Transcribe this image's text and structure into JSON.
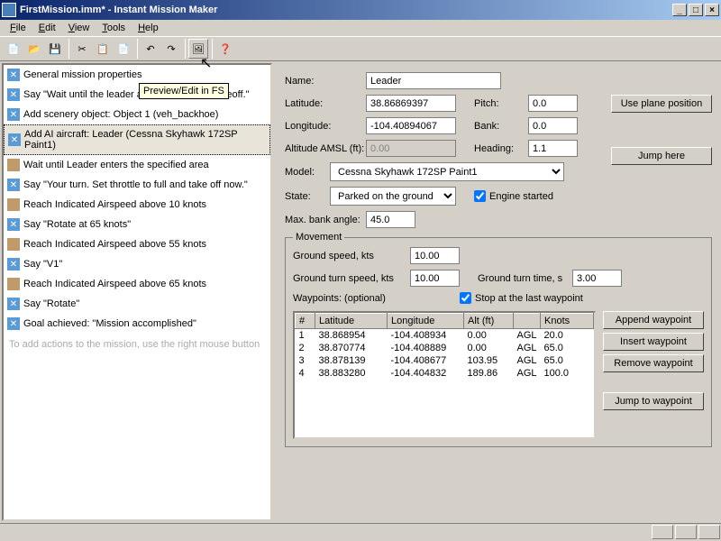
{
  "window": {
    "title": "FirstMission.imm* - Instant Mission Maker",
    "min": "_",
    "max": "□",
    "close": "×"
  },
  "menu": {
    "file": "File",
    "edit": "Edit",
    "view": "View",
    "tools": "Tools",
    "help": "Help"
  },
  "tooltip": "Preview/Edit in FS",
  "actions": [
    {
      "type": "x",
      "txt": "General mission properties"
    },
    {
      "type": "x",
      "txt": "Say \"Wait until the leader aircraft starts the takeoff.\""
    },
    {
      "type": "x",
      "txt": "Add scenery object: Object  1 (veh_backhoe)"
    },
    {
      "type": "x",
      "txt": "Add AI aircraft: Leader (Cessna Skyhawk 172SP Paint1)",
      "sel": true
    },
    {
      "type": "b",
      "txt": "Wait until Leader enters the specified area"
    },
    {
      "type": "x",
      "txt": "Say \"Your turn. Set throttle to full and take off now.\""
    },
    {
      "type": "b",
      "txt": "Reach Indicated Airspeed above 10 knots"
    },
    {
      "type": "x",
      "txt": "Say \"Rotate at 65 knots\""
    },
    {
      "type": "b",
      "txt": "Reach Indicated Airspeed above 55 knots"
    },
    {
      "type": "x",
      "txt": "Say \"V1\""
    },
    {
      "type": "b",
      "txt": "Reach Indicated Airspeed above 65 knots"
    },
    {
      "type": "x",
      "txt": "Say \"Rotate\""
    },
    {
      "type": "x",
      "txt": "Goal achieved: \"Mission accomplished\""
    }
  ],
  "hint": "To add actions to the mission, use the right mouse button",
  "form": {
    "name_l": "Name:",
    "name": "Leader",
    "lat_l": "Latitude:",
    "lat": "38.86869397",
    "lon_l": "Longitude:",
    "lon": "-104.40894067",
    "alt_l": "Altitude AMSL (ft):",
    "alt": "0.00",
    "pitch_l": "Pitch:",
    "pitch": "0.0",
    "bank_l": "Bank:",
    "bank": "0.0",
    "head_l": "Heading:",
    "head": "1.1",
    "model_l": "Model:",
    "model": "Cessna Skyhawk 172SP Paint1",
    "state_l": "State:",
    "state": "Parked on the ground",
    "engine": "Engine started",
    "maxbank_l": "Max. bank angle:",
    "maxbank": "45.0",
    "btn_pos": "Use plane position",
    "btn_jump": "Jump here"
  },
  "movement": {
    "title": "Movement",
    "gs_l": "Ground speed, kts",
    "gs": "10.00",
    "gts_l": "Ground turn speed, kts",
    "gts": "10.00",
    "gtt_l": "Ground turn time, s",
    "gtt": "3.00",
    "wp_l": "Waypoints: (optional)",
    "stop": "Stop at the last waypoint",
    "headers": {
      "n": "#",
      "lat": "Latitude",
      "lon": "Longitude",
      "alt": "Alt (ft)",
      "agl": "",
      "kts": "Knots"
    },
    "rows": [
      {
        "n": "1",
        "lat": "38.868954",
        "lon": "-104.408934",
        "alt": "0.00",
        "agl": "AGL",
        "kts": "20.0"
      },
      {
        "n": "2",
        "lat": "38.870774",
        "lon": "-104.408889",
        "alt": "0.00",
        "agl": "AGL",
        "kts": "65.0"
      },
      {
        "n": "3",
        "lat": "38.878139",
        "lon": "-104.408677",
        "alt": "103.95",
        "agl": "AGL",
        "kts": "65.0"
      },
      {
        "n": "4",
        "lat": "38.883280",
        "lon": "-104.404832",
        "alt": "189.86",
        "agl": "AGL",
        "kts": "100.0"
      }
    ],
    "btn_append": "Append waypoint",
    "btn_insert": "Insert waypoint",
    "btn_remove": "Remove waypoint",
    "btn_jumpwp": "Jump to waypoint"
  }
}
